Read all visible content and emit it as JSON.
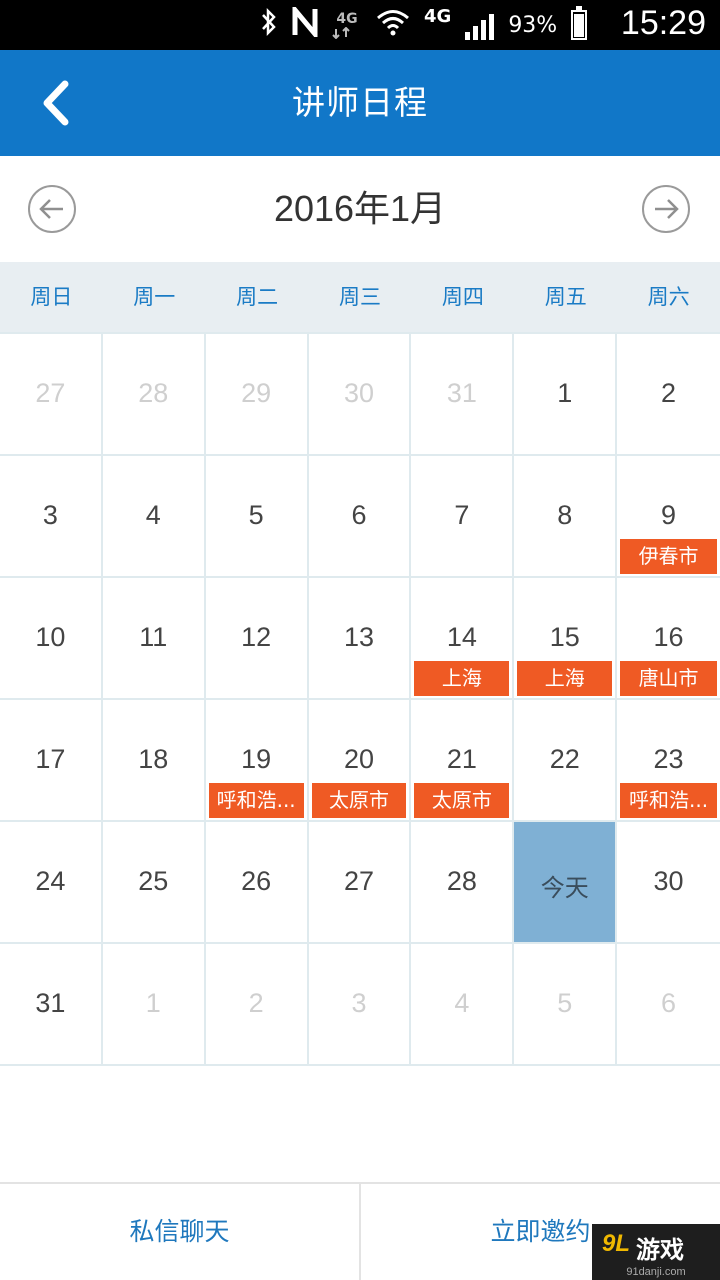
{
  "status_bar": {
    "network_small": "4G",
    "network": "4G",
    "battery_percent": "93%",
    "time": "15:29",
    "icons": [
      "bluetooth-icon",
      "nfc-icon",
      "data-4g-icon",
      "wifi-icon",
      "signal-icon",
      "battery-icon"
    ]
  },
  "app_bar": {
    "title": "讲师日程",
    "back_icon": "back-chevron-icon"
  },
  "calendar": {
    "month_title": "2016年1月",
    "prev_icon": "arrow-left-circle-icon",
    "next_icon": "arrow-right-circle-icon",
    "weekdays": [
      "周日",
      "周一",
      "周二",
      "周三",
      "周四",
      "周五",
      "周六"
    ],
    "today_label": "今天",
    "cells": [
      {
        "day": "27",
        "other": true
      },
      {
        "day": "28",
        "other": true
      },
      {
        "day": "29",
        "other": true
      },
      {
        "day": "30",
        "other": true
      },
      {
        "day": "31",
        "other": true
      },
      {
        "day": "1"
      },
      {
        "day": "2"
      },
      {
        "day": "3"
      },
      {
        "day": "4"
      },
      {
        "day": "5"
      },
      {
        "day": "6"
      },
      {
        "day": "7"
      },
      {
        "day": "8"
      },
      {
        "day": "9",
        "event": "伊春市"
      },
      {
        "day": "10"
      },
      {
        "day": "11"
      },
      {
        "day": "12"
      },
      {
        "day": "13"
      },
      {
        "day": "14",
        "event": "上海"
      },
      {
        "day": "15",
        "event": "上海"
      },
      {
        "day": "16",
        "event": "唐山市"
      },
      {
        "day": "17"
      },
      {
        "day": "18"
      },
      {
        "day": "19",
        "event": "呼和浩..."
      },
      {
        "day": "20",
        "event": "太原市"
      },
      {
        "day": "21",
        "event": "太原市"
      },
      {
        "day": "22"
      },
      {
        "day": "23",
        "event": "呼和浩..."
      },
      {
        "day": "24"
      },
      {
        "day": "25"
      },
      {
        "day": "26"
      },
      {
        "day": "27"
      },
      {
        "day": "28"
      },
      {
        "day": "今天",
        "today": true
      },
      {
        "day": "30"
      },
      {
        "day": "31"
      },
      {
        "day": "1",
        "other": true
      },
      {
        "day": "2",
        "other": true
      },
      {
        "day": "3",
        "other": true
      },
      {
        "day": "4",
        "other": true
      },
      {
        "day": "5",
        "other": true
      },
      {
        "day": "6",
        "other": true
      }
    ]
  },
  "bottom_bar": {
    "chat_label": "私信聊天",
    "invite_label": "立即邀约"
  },
  "watermark": {
    "logo": "9L",
    "text": "游戏",
    "url": "91danji.com"
  },
  "colors": {
    "primary": "#1177c8",
    "event": "#ef5a24",
    "today": "#7fb0d4",
    "weekday_text": "#1a7bc5"
  }
}
